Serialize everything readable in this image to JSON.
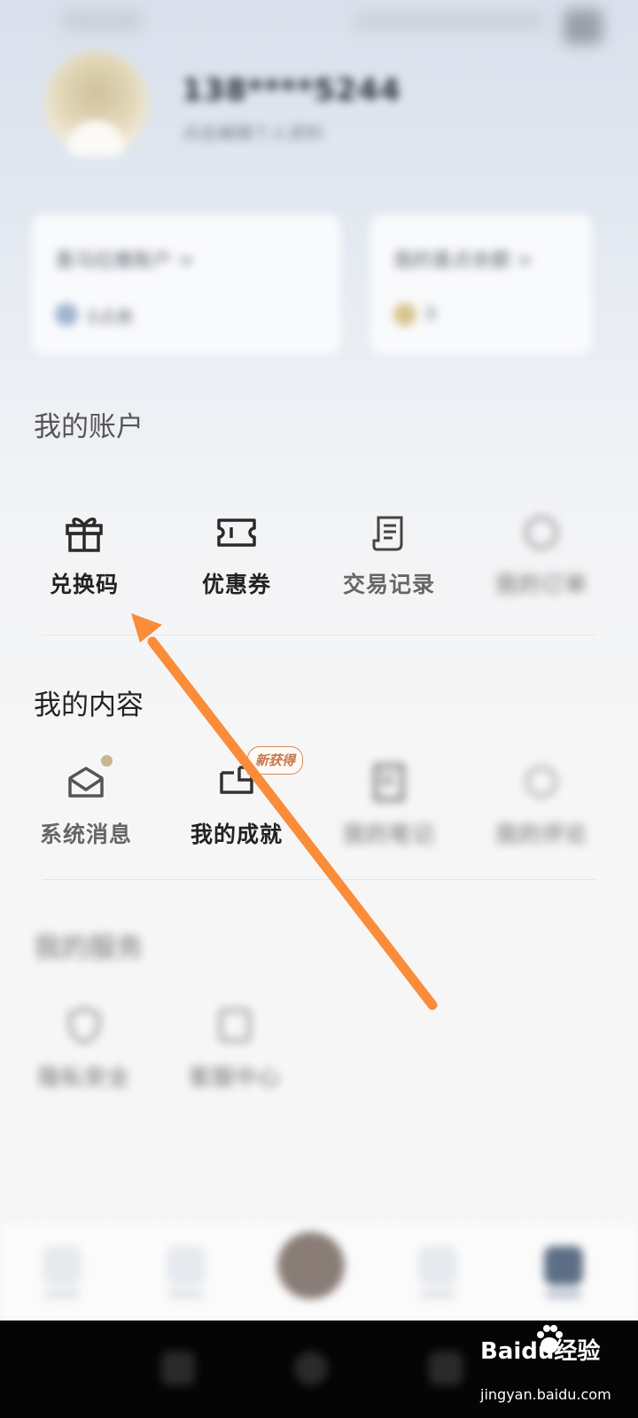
{
  "profile": {
    "username": "138****5244",
    "subtitle": "点击编辑个人资料"
  },
  "cards": [
    {
      "title": "喜马拉雅账户 >",
      "value": "0点券"
    },
    {
      "title": "我的喜点余额 >",
      "value": "0"
    }
  ],
  "account": {
    "title": "我的账户",
    "items": [
      {
        "label": "兑换码",
        "icon": "gift-icon"
      },
      {
        "label": "优惠券",
        "icon": "ticket-icon"
      },
      {
        "label": "交易记录",
        "icon": "receipt-icon"
      },
      {
        "label": "我的订单",
        "icon": "order-icon"
      }
    ]
  },
  "content": {
    "title": "我的内容",
    "items": [
      {
        "label": "系统消息",
        "icon": "envelope-icon"
      },
      {
        "label": "我的成就",
        "icon": "achievement-icon",
        "badge": "新获得"
      },
      {
        "label": "我的笔记",
        "icon": "note-icon"
      },
      {
        "label": "我的评论",
        "icon": "comment-icon"
      }
    ]
  },
  "service": {
    "title": "我的服务",
    "items": [
      {
        "label": "隐私安全",
        "icon": "shield-icon"
      },
      {
        "label": "客服中心",
        "icon": "help-icon"
      }
    ]
  },
  "watermark": {
    "brand": "Baidu经验",
    "url": "jingyan.baidu.com"
  },
  "colors": {
    "arrow": "#fb8c3a",
    "badge": "#d58a5f",
    "dot": "#c8b68e"
  }
}
